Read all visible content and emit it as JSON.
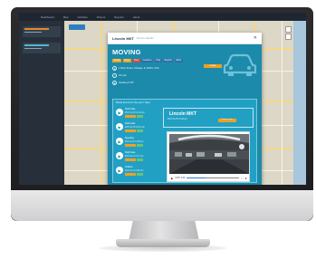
{
  "modal": {
    "title": "Lincoln MKT",
    "subtitle": "Device details",
    "close": "✕",
    "status": "MOVING",
    "tags": [
      {
        "label": "Vehicle",
        "color": "#f0a020"
      },
      {
        "label": "Driver",
        "color": "#f0a020"
      },
      {
        "label": "Fleet",
        "color": "#e0443c"
      },
      {
        "label": "Geofence",
        "color": "#2f6fa8"
      },
      {
        "label": "Trips",
        "color": "#2f6fa8"
      },
      {
        "label": "Reports",
        "color": "#2f6fa8"
      },
      {
        "label": "Alerts",
        "color": "#2f6fa8"
      }
    ],
    "address": "1 Main Street, Chicago, IL 60601, USA",
    "speed": "32 mph",
    "heading": "Heading N 90°",
    "action_label": "Locate",
    "list_title": "Media Events for the past 7 days",
    "events": [
      {
        "title": "Hard brake",
        "time": "2017-11-15 11:43 am"
      },
      {
        "title": "Hard brake",
        "time": "2017-11-15 10:21 am"
      },
      {
        "title": "Speeding",
        "time": "2017-11-14 4:58 pm"
      },
      {
        "title": "Hard brake",
        "time": "2017-11-14 2:17 pm"
      },
      {
        "title": "Collision",
        "time": "2017-11-13 9:05 am"
      }
    ],
    "location_title": "Lincoln MKT",
    "location_sub": "2017-11-15 11:43 am",
    "location_button": "Request video",
    "video": {
      "play": "▶",
      "time": "0:08 / 0:20",
      "fullscreen": "⛶",
      "download": "⬇",
      "progress": 0.35
    }
  },
  "topbar": [
    "Dashboard",
    "Map",
    "Vehicles",
    "Drivers",
    "Reports",
    "Alerts"
  ],
  "colors": {
    "accent": "#1c8bab",
    "warning": "#f0a020",
    "danger": "#e0443c"
  }
}
